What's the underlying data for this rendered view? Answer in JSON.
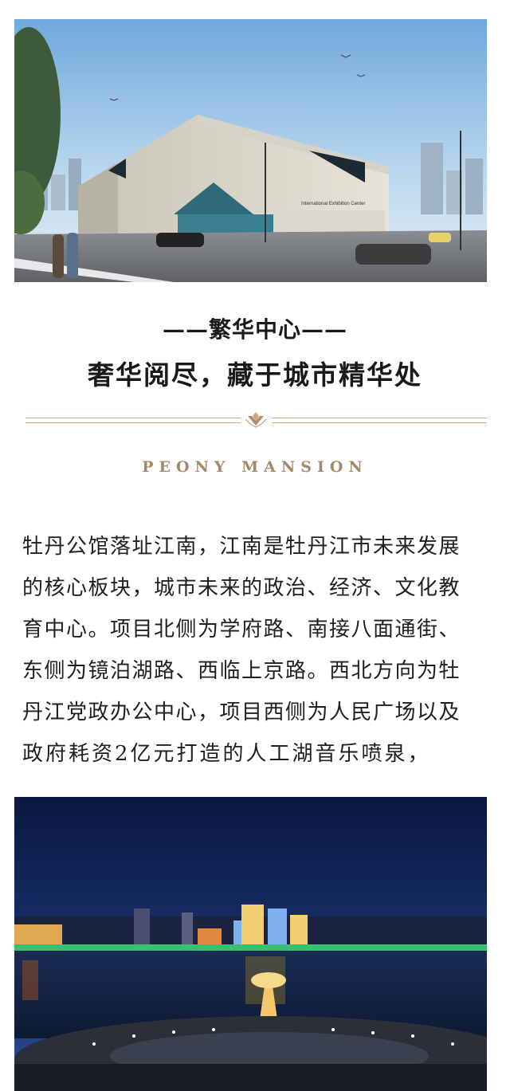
{
  "hero_image": {
    "building_sign": "International Exhibition Center"
  },
  "section": {
    "subtitle": "——繁华中心——",
    "title": "奢华阅尽，藏于城市精华处"
  },
  "brand": {
    "name": "PEONY MANSION",
    "accent_color": "#a5876a"
  },
  "body": {
    "lines": [
      "牡丹公馆落址江南，江南是牡丹江市未来发展",
      "的核心板块，城市未来的政治、经济、文化教",
      "育中心。项目北侧为学府路、南接八面通街、",
      "东侧为镜泊湖路、西临上京路。西北方向为牡",
      "丹江党政办公中心，项目西侧为人民广场以及",
      "政府耗资2亿元打造的人工湖音乐喷泉，"
    ]
  }
}
